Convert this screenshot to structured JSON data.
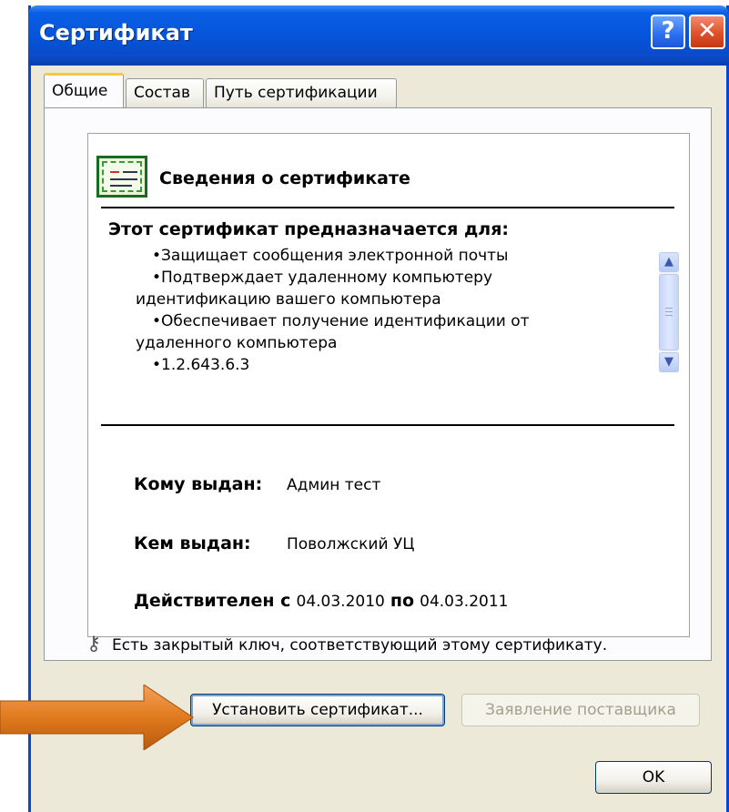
{
  "window": {
    "title": "Сертификат",
    "help_label": "?",
    "close_label": "✕"
  },
  "tabs": [
    {
      "label": "Общие",
      "active": true
    },
    {
      "label": "Состав",
      "active": false
    },
    {
      "label": "Путь сертификации",
      "active": false
    }
  ],
  "info": {
    "heading": "Сведения о сертификате",
    "purpose_title": "Этот сертификат предназначается для:",
    "purposes": {
      "p1": "•Защищает сообщения электронной почты",
      "p2a": "•Подтверждает удаленному компьютеру",
      "p2b": "идентификацию вашего компьютера",
      "p3a": "•Обеспечивает получение идентификации от",
      "p3b": "удаленного компьютера",
      "p4": "•1.2.643.6.3"
    },
    "issued_to_label": "Кому выдан:",
    "issued_to_value": "Админ тест",
    "issued_by_label": "Кем выдан:",
    "issued_by_value": "Поволжский УЦ",
    "valid_from_label": "Действителен с",
    "valid_from_value": "04.03.2010",
    "valid_to_label": "по",
    "valid_to_value": "04.03.2011",
    "private_key_note": "Есть закрытый ключ, соответствующий этому сертификату."
  },
  "buttons": {
    "install_label": "Установить сертификат...",
    "issuer_statement_label": "Заявление поставщика",
    "ok_label": "OK"
  },
  "colors": {
    "titlebar": "#0553d8",
    "dialog_bg": "#ece9d8",
    "arrow": "#e07a1e"
  },
  "icons": {
    "certificate": "certificate-icon",
    "key": "key-icon",
    "help": "help-icon",
    "close": "close-icon",
    "pointer_arrow": "arrow-right-icon"
  }
}
